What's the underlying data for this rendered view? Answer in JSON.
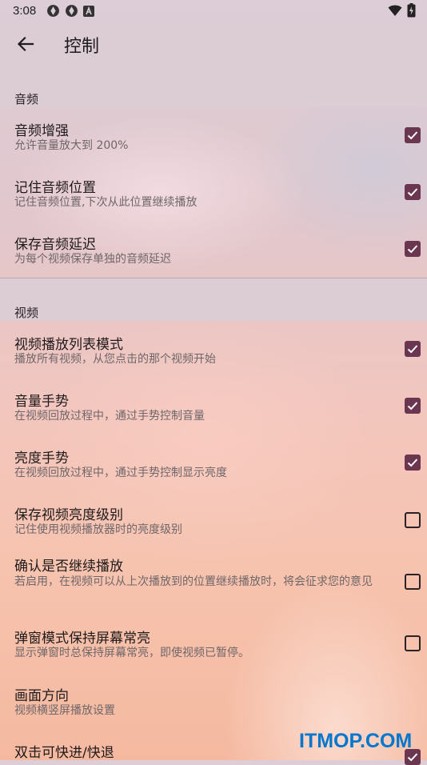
{
  "status_bar": {
    "time": "3:08",
    "icons_left": [
      "app-icon-1",
      "app-icon-2",
      "a-icon"
    ],
    "icons_right": [
      "wifi-icon",
      "battery-icon"
    ]
  },
  "app_bar": {
    "back_icon": "arrow-left-icon",
    "title": "控制"
  },
  "sections": [
    {
      "title": "音频",
      "items": [
        {
          "title": "音频增强",
          "subtitle": "允许音量放大到 200%",
          "checked": true
        },
        {
          "title": "记住音频位置",
          "subtitle": "记住音频位置,下次从此位置继续播放",
          "checked": true
        },
        {
          "title": "保存音频延迟",
          "subtitle": "为每个视频保存单独的音频延迟",
          "checked": true
        }
      ]
    },
    {
      "title": "视频",
      "items": [
        {
          "title": "视频播放列表模式",
          "subtitle": "播放所有视频，从您点击的那个视频开始",
          "checked": true
        },
        {
          "title": "音量手势",
          "subtitle": "在视频回放过程中，通过手势控制音量",
          "checked": true
        },
        {
          "title": "亮度手势",
          "subtitle": "在视频回放过程中，通过手势控制显示亮度",
          "checked": true
        },
        {
          "title": "保存视频亮度级别",
          "subtitle": "记住使用视频播放器时的亮度级别",
          "checked": false
        },
        {
          "title": "确认是否继续播放",
          "subtitle": "若启用，在视频可以从上次播放到的位置继续播放时，将会征求您的意见",
          "checked": false
        },
        {
          "title": "弹窗模式保持屏幕常亮",
          "subtitle": "显示弹窗时总保持屏幕常亮，即使视频已暂停。",
          "checked": false
        },
        {
          "title": "画面方向",
          "subtitle": "视频横竖屏播放设置",
          "checked": null
        },
        {
          "title": "双击可快进/快退",
          "subtitle": "",
          "checked": true
        }
      ]
    }
  ],
  "watermark": "ITMOP.COM",
  "colors": {
    "accent": "#6b3650",
    "watermark": "#0077cc"
  }
}
